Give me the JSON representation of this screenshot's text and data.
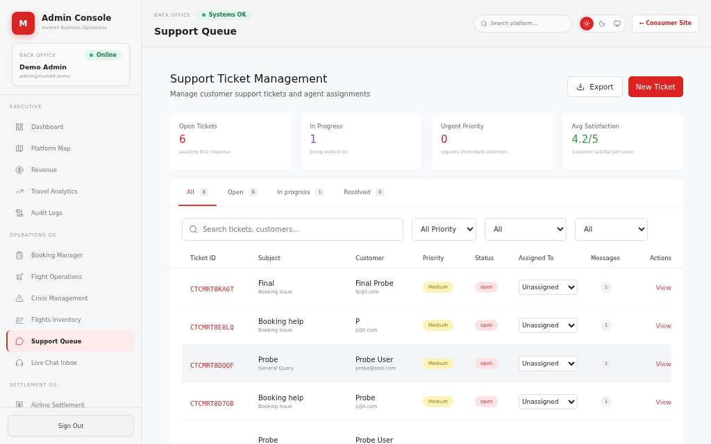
{
  "brand": {
    "logo": "M",
    "title": "Admin Console",
    "subtitle": "mxmmt Business Operations"
  },
  "profile": {
    "label": "BACK OFFICE",
    "status": "Online",
    "name": "Demo Admin",
    "email": "admin@mxmmt.demo"
  },
  "sidebar": {
    "sections": [
      {
        "title": "EXECUTIVE",
        "items": [
          {
            "label": "Dashboard",
            "selected": false
          },
          {
            "label": "Platform Map",
            "selected": false
          },
          {
            "label": "Revenue",
            "selected": false
          },
          {
            "label": "Travel Analytics",
            "selected": false
          },
          {
            "label": "Audit Logs",
            "selected": false
          }
        ]
      },
      {
        "title": "OPERATIONS OS",
        "items": [
          {
            "label": "Booking Manager",
            "selected": false
          },
          {
            "label": "Flight Operations",
            "selected": false
          },
          {
            "label": "Crisis Management",
            "selected": false
          },
          {
            "label": "Flights Inventory",
            "selected": false
          },
          {
            "label": "Support Queue",
            "selected": true
          },
          {
            "label": "Live Chat Inbox",
            "selected": false
          }
        ]
      },
      {
        "title": "SETTLEMENT OS",
        "items": [
          {
            "label": "Airline Settlement",
            "selected": false
          }
        ]
      }
    ],
    "sign_out": "Sign Out"
  },
  "header": {
    "eyebrow": "BACK OFFICE",
    "status": "Systems OK",
    "title": "Support Queue",
    "search_placeholder": "Search platform...",
    "themes": [
      {
        "kind": "light",
        "selected": true
      },
      {
        "kind": "dark",
        "selected": false
      },
      {
        "kind": "system",
        "selected": false
      }
    ],
    "link": "← Consumer Site"
  },
  "page": {
    "title": "Support Ticket Management",
    "subtitle": "Manage customer support tickets and agent assignments",
    "export": "Export",
    "new": "New Ticket"
  },
  "stats": [
    {
      "label": "Open Tickets",
      "value": "6",
      "note": "awaiting first response",
      "color": "#c62828"
    },
    {
      "label": "In Progress",
      "value": "1",
      "note": "being worked on",
      "color": "#8e3ccf"
    },
    {
      "label": "Urgent Priority",
      "value": "0",
      "note": "requires immediate attention",
      "color": "#c62828"
    },
    {
      "label": "Avg Satisfaction",
      "value": "4.2/5",
      "note": "customer satisfaction score",
      "color": "#2e9a4a"
    }
  ],
  "tabs": [
    {
      "label": "All",
      "count": "8",
      "selected": true
    },
    {
      "label": "Open",
      "count": "6",
      "selected": false
    },
    {
      "label": "In progress",
      "count": "1",
      "selected": false
    },
    {
      "label": "Resolved",
      "count": "0",
      "selected": false
    }
  ],
  "filters": {
    "search_placeholder": "Search tickets, customers...",
    "selects": [
      "All Priority",
      "All",
      "All"
    ]
  },
  "table": {
    "columns": [
      "Ticket ID",
      "Subject",
      "Customer",
      "Priority",
      "Status",
      "Assigned To",
      "Messages",
      "Actions"
    ],
    "rows": [
      {
        "id": "CTCMRT8KA6T",
        "subject": "Final",
        "category": "Booking Issue",
        "customer": "Final Probe",
        "email": "fp@t.com",
        "priority": "Medium",
        "status": "open",
        "assigned": "Unassigned",
        "messages": "1",
        "action": "View",
        "selected": false
      },
      {
        "id": "CTCMRT8E8LQ",
        "subject": "Booking help",
        "category": "Booking Issue",
        "customer": "P",
        "email": "p@t.com",
        "priority": "Medium",
        "status": "open",
        "assigned": "Unassigned",
        "messages": "1",
        "action": "View",
        "selected": false
      },
      {
        "id": "CTCMRT8DQQF",
        "subject": "Probe",
        "category": "General Query",
        "customer": "Probe User",
        "email": "probe@test.com",
        "priority": "Medium",
        "status": "open",
        "assigned": "Unassigned",
        "messages": "1",
        "action": "View",
        "selected": true
      },
      {
        "id": "CTCMRT8D7GB",
        "subject": "Booking help",
        "category": "Booking Issue",
        "customer": "Probe",
        "email": "p@t.com",
        "priority": "Medium",
        "status": "open",
        "assigned": "Unassigned",
        "messages": "1",
        "action": "View",
        "selected": false
      },
      {
        "subject": "Probe",
        "customer": "Probe User"
      }
    ]
  }
}
